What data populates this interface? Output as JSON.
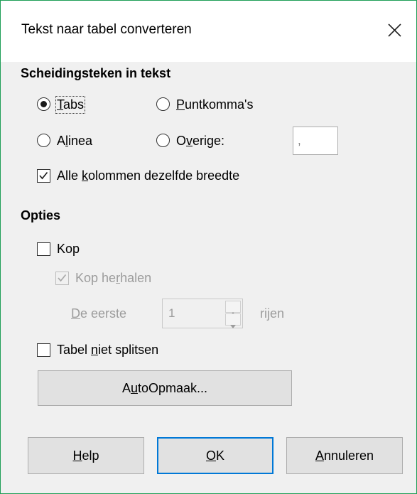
{
  "window": {
    "title": "Tekst naar tabel converteren",
    "close_icon": "close-icon"
  },
  "separator": {
    "title": "Scheidingsteken in tekst",
    "options": {
      "tabs": {
        "before": "",
        "key": "T",
        "after": "abs",
        "checked": true
      },
      "puntkomma": {
        "before": "",
        "key": "P",
        "after": "untkomma's",
        "checked": false
      },
      "alinea": {
        "before": "A",
        "key": "l",
        "after": "inea",
        "checked": false
      },
      "overige": {
        "before": "O",
        "key": "v",
        "after": "erige:",
        "checked": false
      }
    },
    "other_value": ",",
    "equal_width": {
      "before": "Alle ",
      "key": "k",
      "after": "olommen dezelfde breedte",
      "checked": true
    }
  },
  "options": {
    "title": "Opties",
    "kop": {
      "label": "Kop",
      "checked": false
    },
    "kop_herhalen": {
      "before": "Kop he",
      "key": "r",
      "after": "halen",
      "checked": true,
      "disabled": true
    },
    "de_eerste": {
      "before": "",
      "key": "D",
      "after": "e eerste"
    },
    "rows_value": "1",
    "rows_suffix": "rijen",
    "niet_splitsen": {
      "before": "Tabel ",
      "key": "n",
      "after": "iet splitsen",
      "checked": false
    }
  },
  "buttons": {
    "autoformat": {
      "before": "A",
      "key": "u",
      "after": "toOpmaak..."
    },
    "help": {
      "before": "",
      "key": "H",
      "after": "elp"
    },
    "ok": {
      "before": "",
      "key": "O",
      "after": "K"
    },
    "cancel": {
      "before": "",
      "key": "A",
      "after": "nnuleren"
    }
  },
  "colors": {
    "window_border": "#1e9e57",
    "default_button_border": "#0078d7",
    "disabled_text": "#9c9c9c"
  }
}
